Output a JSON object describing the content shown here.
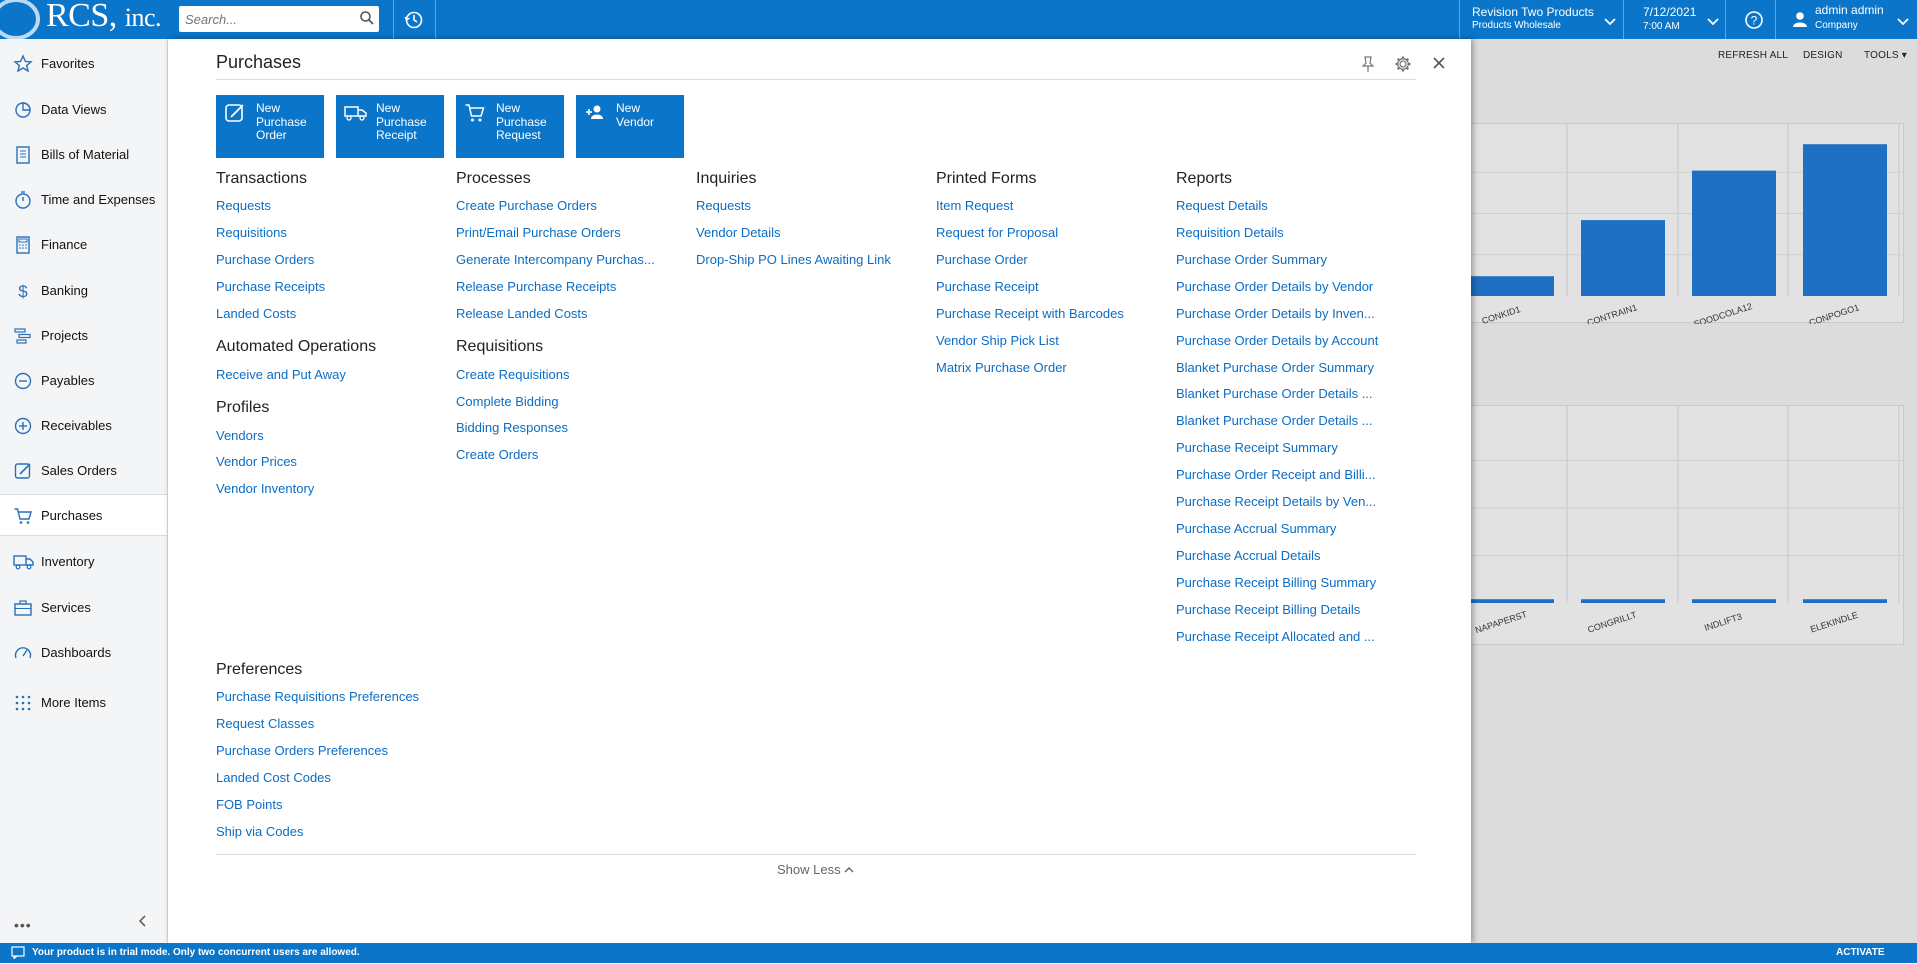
{
  "topbar": {
    "logo_main": "RCS,",
    "logo_suffix": "inc.",
    "search_placeholder": "Search...",
    "company_name": "Revision Two Products",
    "company_branch": "Products Wholesale",
    "date": "7/12/2021",
    "time": "7:00 AM",
    "user_name": "admin admin",
    "user_role": "Company",
    "icons": {
      "search": "search-icon",
      "history": "history-icon",
      "help": "help-icon",
      "user": "user-icon"
    }
  },
  "sidebar": {
    "items": [
      {
        "label": "Favorites",
        "icon": "star-icon"
      },
      {
        "label": "Data Views",
        "icon": "pie-chart-icon"
      },
      {
        "label": "Bills of Material",
        "icon": "bill-icon"
      },
      {
        "label": "Time and Expenses",
        "icon": "stopwatch-icon"
      },
      {
        "label": "Finance",
        "icon": "calculator-icon"
      },
      {
        "label": "Banking",
        "icon": "dollar-icon"
      },
      {
        "label": "Projects",
        "icon": "gantt-icon"
      },
      {
        "label": "Payables",
        "icon": "minus-circle-icon"
      },
      {
        "label": "Receivables",
        "icon": "plus-circle-icon"
      },
      {
        "label": "Sales Orders",
        "icon": "edit-icon"
      },
      {
        "label": "Purchases",
        "icon": "cart-icon"
      },
      {
        "label": "Inventory",
        "icon": "truck-icon"
      },
      {
        "label": "Services",
        "icon": "briefcase-icon"
      },
      {
        "label": "Dashboards",
        "icon": "gauge-icon"
      },
      {
        "label": "More Items",
        "icon": "grid-dots-icon"
      }
    ],
    "active": "Purchases",
    "more": "•••"
  },
  "dashboard": {
    "toolbar": [
      "REFRESH ALL",
      "DESIGN",
      "TOOLS"
    ],
    "chart_top": {
      "categories": [
        "CONKID1",
        "CONTRAIN1",
        "FOODCOLA12",
        "CONPOGO1"
      ]
    },
    "chart_bottom": {
      "categories": [
        "NAPAPERST",
        "CONGRILLT",
        "INDLIFT3",
        "ELEKINDLE"
      ]
    }
  },
  "chart_data": [
    {
      "type": "bar",
      "categories": [
        "CONKID1",
        "CONTRAIN1",
        "FOODCOLA12",
        "CONPOGO1"
      ],
      "values": [
        12,
        46,
        76,
        92
      ],
      "title": "",
      "xlabel": "",
      "ylabel": "",
      "grid": true
    },
    {
      "type": "bar",
      "categories": [
        "NAPAPERST",
        "CONGRILLT",
        "INDLIFT3",
        "ELEKINDLE"
      ],
      "values": [
        2,
        2,
        2,
        2
      ],
      "title": "",
      "xlabel": "",
      "ylabel": "",
      "grid": true
    }
  ],
  "panel": {
    "title": "Purchases",
    "quick_buttons": [
      {
        "label": "New\nPurchase\nOrder",
        "icon": "edit-icon"
      },
      {
        "label": "New\nPurchase\nReceipt",
        "icon": "truck-icon"
      },
      {
        "label": "New\nPurchase\nRequest",
        "icon": "cart-icon"
      },
      {
        "label": "New\nVendor",
        "icon": "add-user-icon"
      }
    ],
    "transactions": {
      "title": "Transactions",
      "links": [
        "Requests",
        "Requisitions",
        "Purchase Orders",
        "Purchase Receipts",
        "Landed Costs"
      ]
    },
    "automated": {
      "title": "Automated Operations",
      "links": [
        "Receive and Put Away"
      ]
    },
    "profiles": {
      "title": "Profiles",
      "links": [
        "Vendors",
        "Vendor Prices",
        "Vendor Inventory"
      ]
    },
    "processes": {
      "title": "Processes",
      "links": [
        "Create Purchase Orders",
        "Print/Email Purchase Orders",
        "Generate Intercompany Purchas...",
        "Release Purchase Receipts",
        "Release Landed Costs"
      ]
    },
    "requisitions": {
      "title": "Requisitions",
      "links": [
        "Create Requisitions",
        "Complete Bidding",
        "Bidding Responses",
        "Create Orders"
      ]
    },
    "inquiries": {
      "title": "Inquiries",
      "links": [
        "Requests",
        "Vendor Details",
        "Drop-Ship PO Lines Awaiting Link"
      ]
    },
    "printed": {
      "title": "Printed Forms",
      "links": [
        "Item Request",
        "Request for Proposal",
        "Purchase Order",
        "Purchase Receipt",
        "Purchase Receipt with Barcodes",
        "Vendor Ship Pick List",
        "Matrix Purchase Order"
      ]
    },
    "reports": {
      "title": "Reports",
      "links": [
        "Request Details",
        "Requisition Details",
        "Purchase Order Summary",
        "Purchase Order Details by Vendor",
        "Purchase Order Details by Inven...",
        "Purchase Order Details by Account",
        "Blanket Purchase Order Summary",
        "Blanket Purchase Order Details ...",
        "Blanket Purchase Order Details ...",
        "Purchase Receipt Summary",
        "Purchase Order Receipt and Billi...",
        "Purchase Receipt Details by Ven...",
        "Purchase Accrual Summary",
        "Purchase Accrual Details",
        "Purchase Receipt Billing Summary",
        "Purchase Receipt Billing Details",
        "Purchase Receipt Allocated and ..."
      ]
    },
    "preferences": {
      "title": "Preferences",
      "links": [
        "Purchase Requisitions Preferences",
        "Request Classes",
        "Purchase Orders Preferences",
        "Landed Cost Codes",
        "FOB Points",
        "Ship via Codes"
      ]
    },
    "show_less": "Show Less"
  },
  "footer": {
    "message": "Your product is in trial mode. Only two concurrent users are allowed.",
    "action": "ACTIVATE"
  },
  "colors": {
    "brand": "#0b76c9",
    "link": "#0b6dc4",
    "bar": "#1f6fc5"
  }
}
